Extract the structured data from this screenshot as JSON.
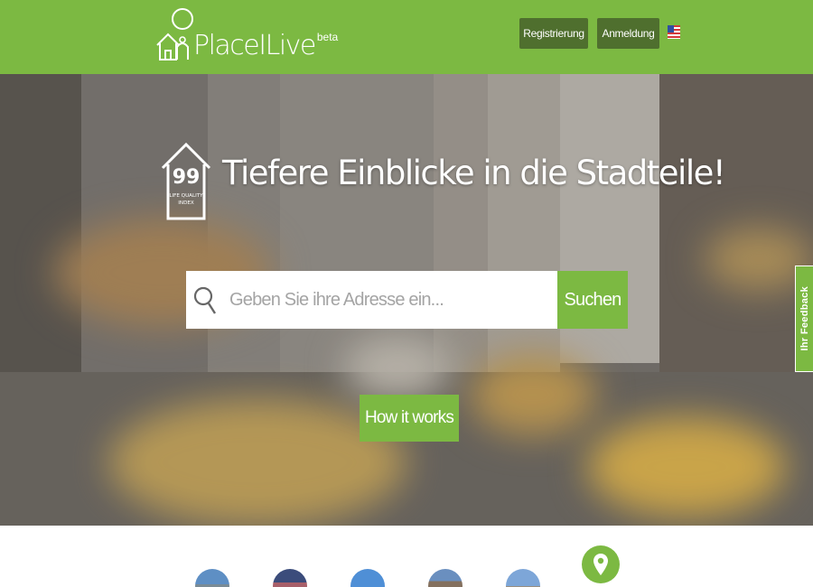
{
  "header": {
    "logo_text": "PlaceILive",
    "logo_beta": "beta",
    "register_label": "Registrierung",
    "login_label": "Anmeldung",
    "language_flag": "us-flag-icon"
  },
  "hero": {
    "lqi_number": "99",
    "lqi_label_line1": "LIFE QUALITY",
    "lqi_label_line2": "INDEX",
    "title": "Tiefere Einblicke in die Stadteile!",
    "search_placeholder": "Geben Sie ihre Adresse ein...",
    "search_button": "Suchen",
    "how_button": "How it works"
  },
  "feedback": {
    "label": "Ihr Feedback"
  },
  "cities": [
    {
      "icon": "city-photo-icon"
    },
    {
      "icon": "city-photo-icon"
    },
    {
      "icon": "city-photo-icon"
    },
    {
      "icon": "city-photo-icon"
    },
    {
      "icon": "city-photo-icon"
    },
    {
      "icon": "location-pin-icon"
    }
  ],
  "colors": {
    "brand_green": "#7cb942",
    "nav_button": "#4f6f2e"
  }
}
